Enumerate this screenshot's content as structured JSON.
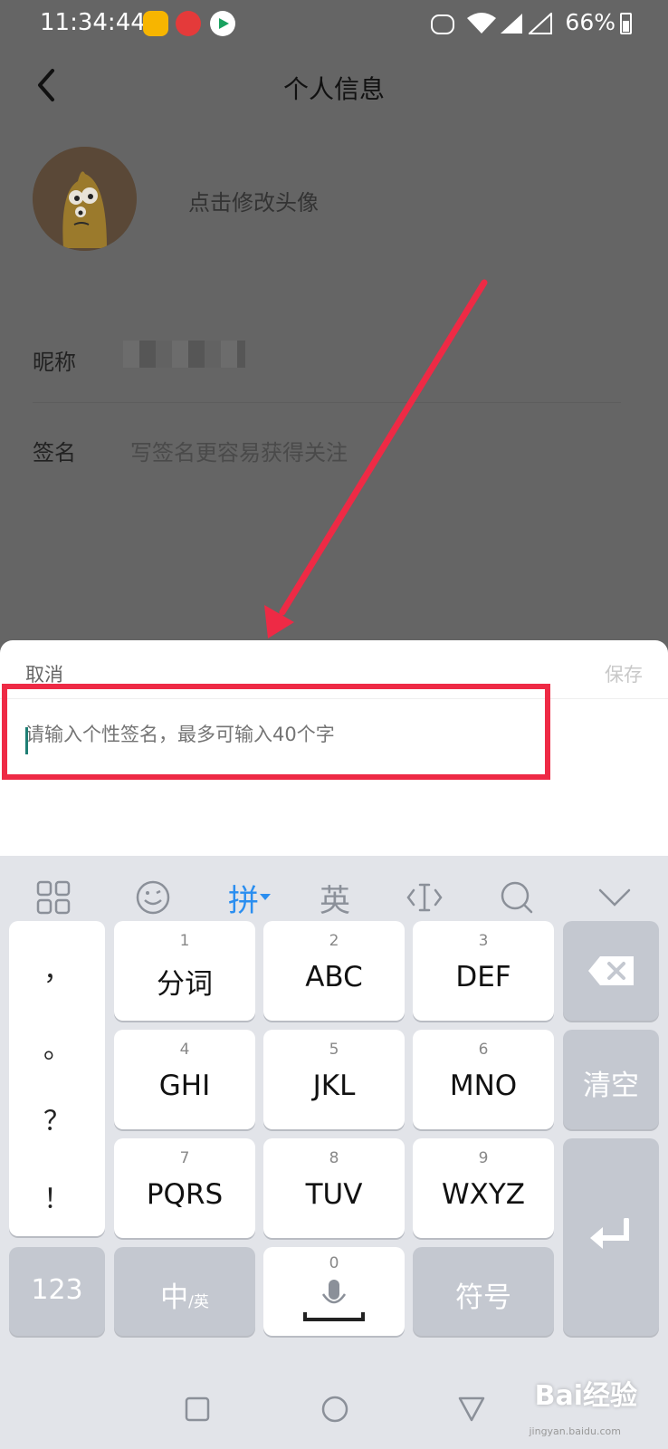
{
  "status_bar": {
    "time": "11:34:44",
    "battery": "66%"
  },
  "header": {
    "title": "个人信息"
  },
  "profile": {
    "avatar_hint": "点击修改头像",
    "nickname_label": "昵称",
    "signature_label": "签名",
    "signature_placeholder": "写签名更容易获得关注"
  },
  "sheet": {
    "cancel_label": "取消",
    "save_label": "保存",
    "input_placeholder": "请输入个性签名，最多可输入40个字",
    "input_value": ""
  },
  "keyboard": {
    "toolbar": {
      "pinyin": "拼",
      "english": "英"
    },
    "punctuation": [
      "，",
      "。",
      "？",
      "！"
    ],
    "keys": [
      {
        "num": "1",
        "label": "分词"
      },
      {
        "num": "2",
        "label": "ABC"
      },
      {
        "num": "3",
        "label": "DEF"
      },
      {
        "num": "4",
        "label": "GHI"
      },
      {
        "num": "5",
        "label": "JKL"
      },
      {
        "num": "6",
        "label": "MNO"
      },
      {
        "num": "7",
        "label": "PQRS"
      },
      {
        "num": "8",
        "label": "TUV"
      },
      {
        "num": "9",
        "label": "WXYZ"
      }
    ],
    "clear_label": "清空",
    "numbers_label": "123",
    "lang_main": "中",
    "lang_sub": "/英",
    "space_num": "0",
    "symbols_label": "符号"
  },
  "watermark": {
    "text": "Bai经验",
    "sub": "jingyan.baidu.com"
  },
  "colors": {
    "accent_blue": "#2a8ef0",
    "highlight_red": "#ee2a45",
    "keyboard_bg": "#e2e4e9"
  }
}
